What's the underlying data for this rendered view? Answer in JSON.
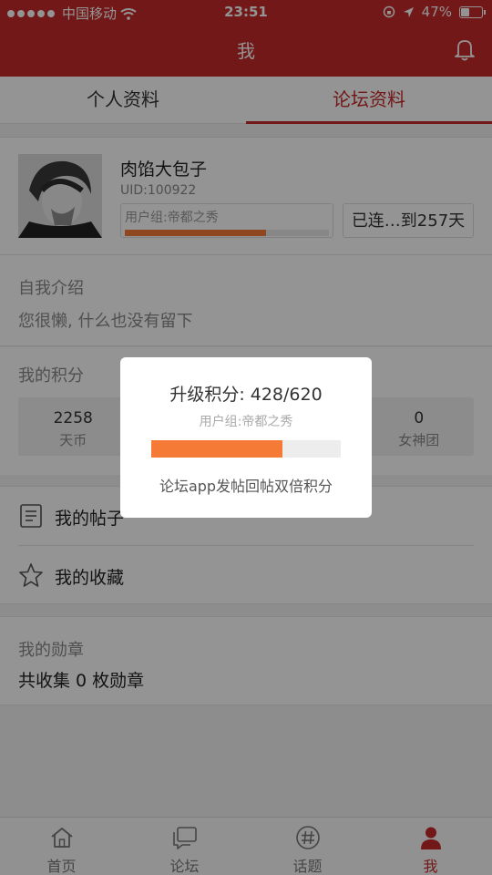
{
  "status_bar": {
    "carrier": "中国移动",
    "time": "23:51",
    "battery_percent": "47%",
    "battery_level": 0.47
  },
  "nav": {
    "title": "我"
  },
  "tabs": [
    {
      "label": "个人资料"
    },
    {
      "label": "论坛资料"
    }
  ],
  "profile": {
    "username": "肉馅大包子",
    "uid": "UID:100922",
    "group_label": "用户组:帝都之秀",
    "group_progress": 0.69,
    "sign_text": "已连…到257天"
  },
  "intro": {
    "heading": "自我介绍",
    "text": "您很懒, 什么也没有留下"
  },
  "points": {
    "heading": "我的积分",
    "items": [
      {
        "value": "2258",
        "label": "天币"
      },
      {
        "value": "",
        "label": ""
      },
      {
        "value": "",
        "label": ""
      },
      {
        "value": "0",
        "label": "女神团"
      }
    ]
  },
  "menu": [
    {
      "label": "我的帖子"
    },
    {
      "label": "我的收藏"
    }
  ],
  "badges": {
    "heading": "我的勋章",
    "text": "共收集 0 枚勋章"
  },
  "bottom_nav": [
    {
      "label": "首页",
      "icon": "home-icon"
    },
    {
      "label": "论坛",
      "icon": "chat-icon"
    },
    {
      "label": "话题",
      "icon": "hashtag-icon"
    },
    {
      "label": "我",
      "icon": "person-icon"
    }
  ],
  "modal": {
    "title": "升级积分: 428/620",
    "group": "用户组:帝都之秀",
    "progress": 0.69,
    "note": "论坛app发帖回帖双倍积分"
  },
  "colors": {
    "brand": "#c62a2a",
    "progress": "#f47a35"
  }
}
